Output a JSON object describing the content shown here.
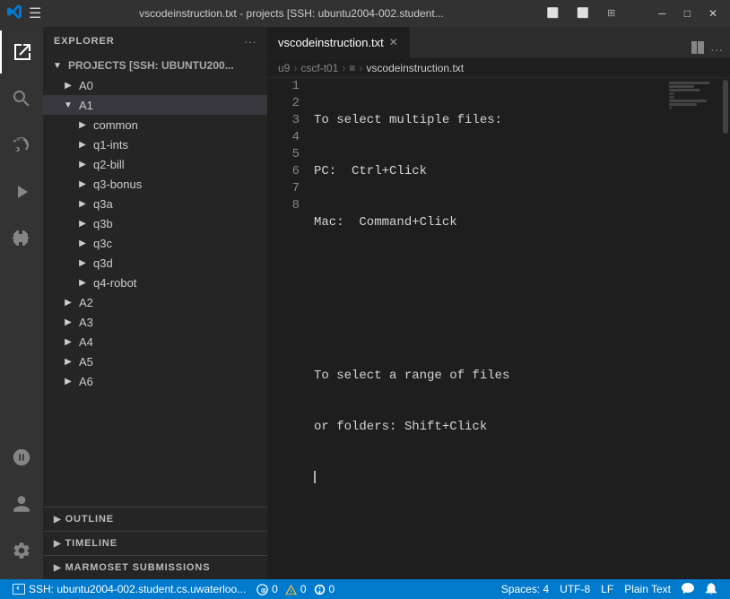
{
  "titlebar": {
    "title": "vscodeinstruction.txt - projects [SSH: ubuntu2004-002.student...",
    "menu_icon": "☰",
    "vscode_icon": "VS",
    "controls": {
      "minimize": "─",
      "maximize": "□",
      "close": "✕"
    },
    "layout_icons": [
      "⬜",
      "⬜",
      "⊞"
    ]
  },
  "activity_bar": {
    "items": [
      {
        "name": "explorer-icon",
        "icon": "⎗",
        "active": true
      },
      {
        "name": "search-icon",
        "icon": "🔍",
        "active": false
      },
      {
        "name": "source-control-icon",
        "icon": "⑂",
        "active": false
      },
      {
        "name": "run-debug-icon",
        "icon": "▷",
        "active": false
      },
      {
        "name": "extensions-icon",
        "icon": "⊞",
        "active": false
      }
    ],
    "bottom_items": [
      {
        "name": "remote-icon",
        "icon": "⊞"
      },
      {
        "name": "account-icon",
        "icon": "◯"
      },
      {
        "name": "settings-icon",
        "icon": "⚙"
      }
    ]
  },
  "sidebar": {
    "header": {
      "title": "EXPLORER",
      "more_icon": "···"
    },
    "tree": {
      "root": {
        "label": "PROJECTS [SSH: UBUNTUOO...",
        "expanded": true
      },
      "items": [
        {
          "id": "A0",
          "label": "A0",
          "level": 1,
          "expanded": false,
          "arrow": "▶"
        },
        {
          "id": "A1",
          "label": "A1",
          "level": 1,
          "expanded": true,
          "arrow": "▼",
          "selected": true
        },
        {
          "id": "common",
          "label": "common",
          "level": 2,
          "expanded": false,
          "arrow": "▶"
        },
        {
          "id": "q1-ints",
          "label": "q1-ints",
          "level": 2,
          "expanded": false,
          "arrow": "▶"
        },
        {
          "id": "q2-bill",
          "label": "q2-bill",
          "level": 2,
          "expanded": false,
          "arrow": "▶"
        },
        {
          "id": "q3-bonus",
          "label": "q3-bonus",
          "level": 2,
          "expanded": false,
          "arrow": "▶"
        },
        {
          "id": "q3a",
          "label": "q3a",
          "level": 2,
          "expanded": false,
          "arrow": "▶"
        },
        {
          "id": "q3b",
          "label": "q3b",
          "level": 2,
          "expanded": false,
          "arrow": "▶"
        },
        {
          "id": "q3c",
          "label": "q3c",
          "level": 2,
          "expanded": false,
          "arrow": "▶"
        },
        {
          "id": "q3d",
          "label": "q3d",
          "level": 2,
          "expanded": false,
          "arrow": "▶"
        },
        {
          "id": "q4-robot",
          "label": "q4-robot",
          "level": 2,
          "expanded": false,
          "arrow": "▶"
        },
        {
          "id": "A2",
          "label": "A2",
          "level": 1,
          "expanded": false,
          "arrow": "▶"
        },
        {
          "id": "A3",
          "label": "A3",
          "level": 1,
          "expanded": false,
          "arrow": "▶"
        },
        {
          "id": "A4",
          "label": "A4",
          "level": 1,
          "expanded": false,
          "arrow": "▶"
        },
        {
          "id": "A5",
          "label": "A5",
          "level": 1,
          "expanded": false,
          "arrow": "▶"
        },
        {
          "id": "A6",
          "label": "A6",
          "level": 1,
          "expanded": false,
          "arrow": "▶"
        }
      ]
    },
    "sections": [
      {
        "id": "outline",
        "label": "OUTLINE",
        "arrow": "▶"
      },
      {
        "id": "timeline",
        "label": "TIMELINE",
        "arrow": "▶"
      },
      {
        "id": "marmoset",
        "label": "MARMOSET SUBMISSIONS",
        "arrow": "▶"
      }
    ]
  },
  "editor": {
    "tabs": [
      {
        "id": "vscodeinstruction",
        "label": "vscodeinstruction.txt",
        "active": true,
        "close_icon": "✕"
      }
    ],
    "breadcrumb": [
      {
        "label": "u9",
        "dim": true
      },
      {
        "label": "cscf-t01",
        "dim": true
      },
      {
        "label": "≡",
        "dim": true
      },
      {
        "label": "vscodeinstruction.txt",
        "dim": false
      }
    ],
    "lines": [
      {
        "num": 1,
        "text": "To select multiple files:"
      },
      {
        "num": 2,
        "text": "PC:  Ctrl+Click"
      },
      {
        "num": 3,
        "text": "Mac:  Command+Click"
      },
      {
        "num": 4,
        "text": ""
      },
      {
        "num": 5,
        "text": ""
      },
      {
        "num": 6,
        "text": "To select a range of files"
      },
      {
        "num": 7,
        "text": "or folders: Shift+Click"
      },
      {
        "num": 8,
        "text": "",
        "cursor": true
      }
    ]
  },
  "status_bar": {
    "ssh_label": "⌁ SSH: ubuntu2004-002.student.cs.uwaterloo...",
    "errors": "⊗ 0",
    "warnings": "⚠ 0",
    "info": "🔔 0",
    "spaces": "Spaces: 4",
    "encoding": "UTF-8",
    "eol": "LF",
    "language": "Plain Text",
    "feedback_icon": "⚑",
    "bell_icon": "🔔"
  }
}
